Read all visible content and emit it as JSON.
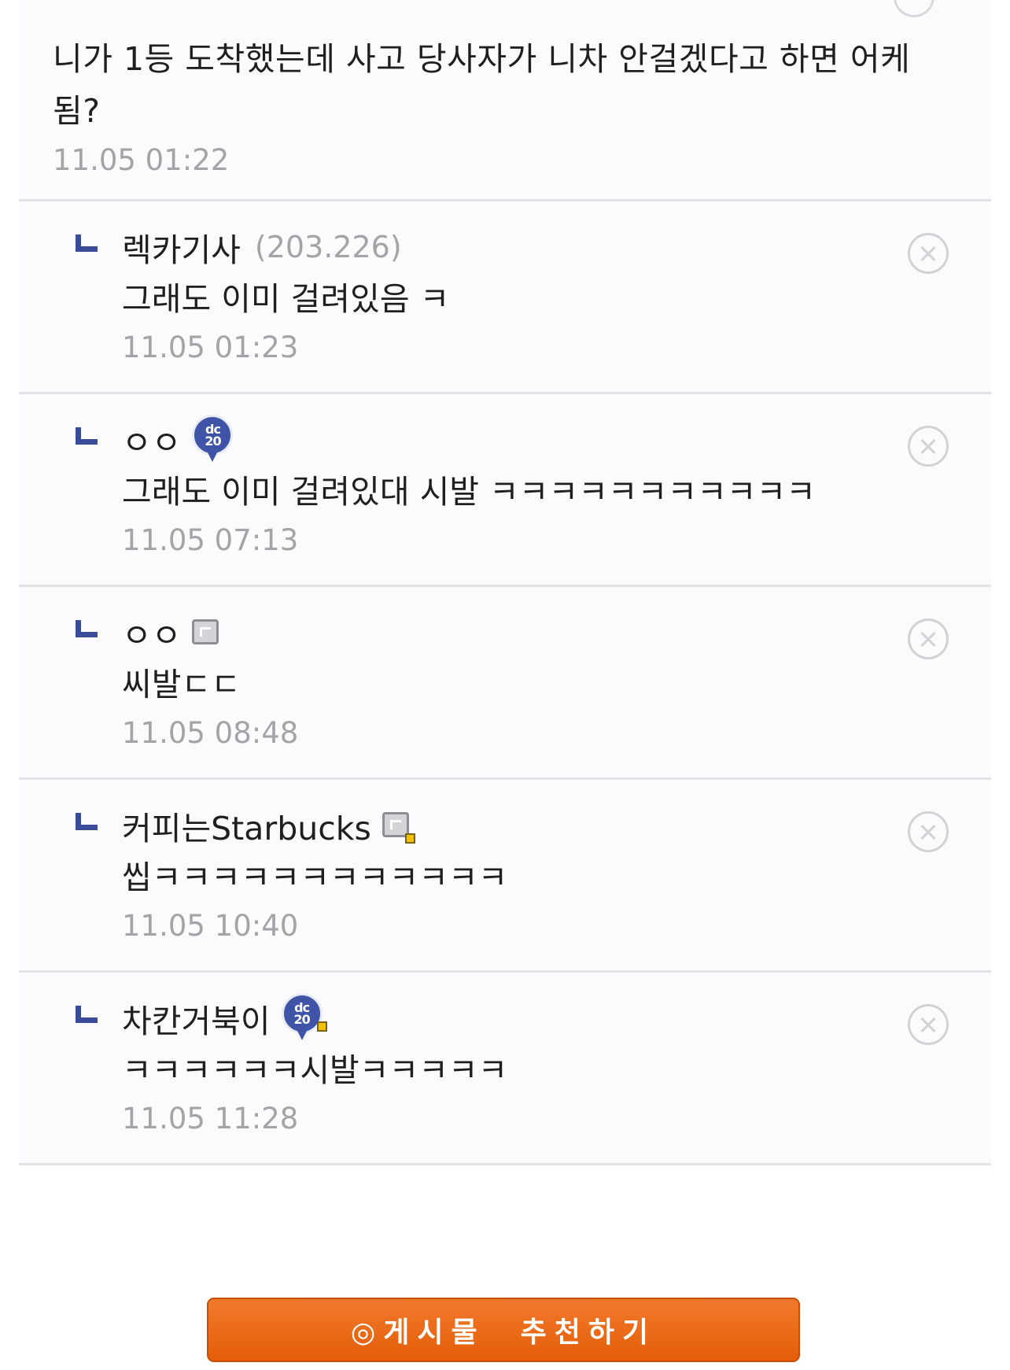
{
  "top_comment": {
    "text": "니가 1등 도착했는데 사고 당사자가 니차 안걸겠다고 하면 어케 됨?",
    "time": "11.05 01:22"
  },
  "replies": [
    {
      "nickname": "렉카기사",
      "ip": "(203.226)",
      "badge": "",
      "text": "그래도 이미 걸려있음 ㅋ",
      "time": "11.05 01:23"
    },
    {
      "nickname": "ㅇㅇ",
      "ip": "",
      "badge": "dc-gonik-icon",
      "text": "그래도 이미 걸려있대 시발 ㅋㅋㅋㅋㅋㅋㅋㅋㅋㅋㅋ",
      "time": "11.05 07:13"
    },
    {
      "nickname": "ㅇㅇ",
      "ip": "",
      "badge": "fixed-nick-icon",
      "text": "씨발ㄷㄷ",
      "time": "11.05 08:48"
    },
    {
      "nickname": "커피는Starbucks",
      "ip": "",
      "badge": "fixed-nick-manager-icon",
      "text": "씹ㅋㅋㅋㅋㅋㅋㅋㅋㅋㅋㅋㅋ",
      "time": "11.05 10:40"
    },
    {
      "nickname": "차칸거북이",
      "ip": "",
      "badge": "dc-gonik-manager-icon",
      "text": "ㅋㅋㅋㅋㅋㅋ시발ㅋㅋㅋㅋㅋ",
      "time": "11.05 11:28"
    }
  ],
  "badge_text": "dc\n20",
  "recommend_button": {
    "label": "◎게시물  추천하기"
  },
  "colors": {
    "accent_orange": "#e86510",
    "reply_arrow_blue": "#3a4b9a",
    "meta_gray": "#a4a4a8",
    "divider": "#e2e2e6"
  }
}
